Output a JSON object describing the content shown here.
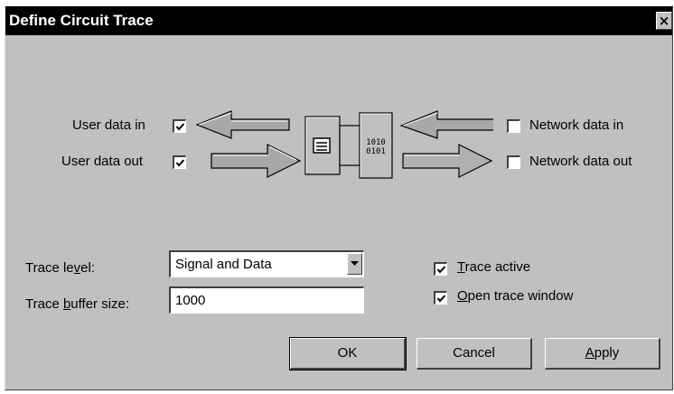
{
  "window": {
    "title": "Define Circuit Trace",
    "close_glyph": "×"
  },
  "diagram": {
    "user_data_in": {
      "label": "User data in",
      "checked": true
    },
    "user_data_out": {
      "label": "User data out",
      "checked": true
    },
    "network_data_in": {
      "label": "Network data in",
      "checked": false
    },
    "network_data_out": {
      "label": "Network data out",
      "checked": false
    },
    "binary_icon_text_top": "1010",
    "binary_icon_text_bottom": "0101"
  },
  "trace_level": {
    "label_pre": "Trace le",
    "label_accel": "v",
    "label_post": "el:",
    "value": "Signal and Data"
  },
  "trace_buffer": {
    "label_pre": "Trace ",
    "label_accel": "b",
    "label_post": "uffer size:",
    "value": "1000"
  },
  "trace_active": {
    "label_accel": "T",
    "label_rest": "race active",
    "checked": true
  },
  "open_trace_window": {
    "label_accel": "O",
    "label_rest": "pen trace window",
    "checked": true
  },
  "buttons": {
    "ok": "OK",
    "cancel": "Cancel",
    "apply_accel": "A",
    "apply_rest": "pply"
  },
  "colors": {
    "title_bg": "#000000",
    "dialog_bg": "#c0c0c0",
    "arrow_fill": "#a0a0a0"
  }
}
